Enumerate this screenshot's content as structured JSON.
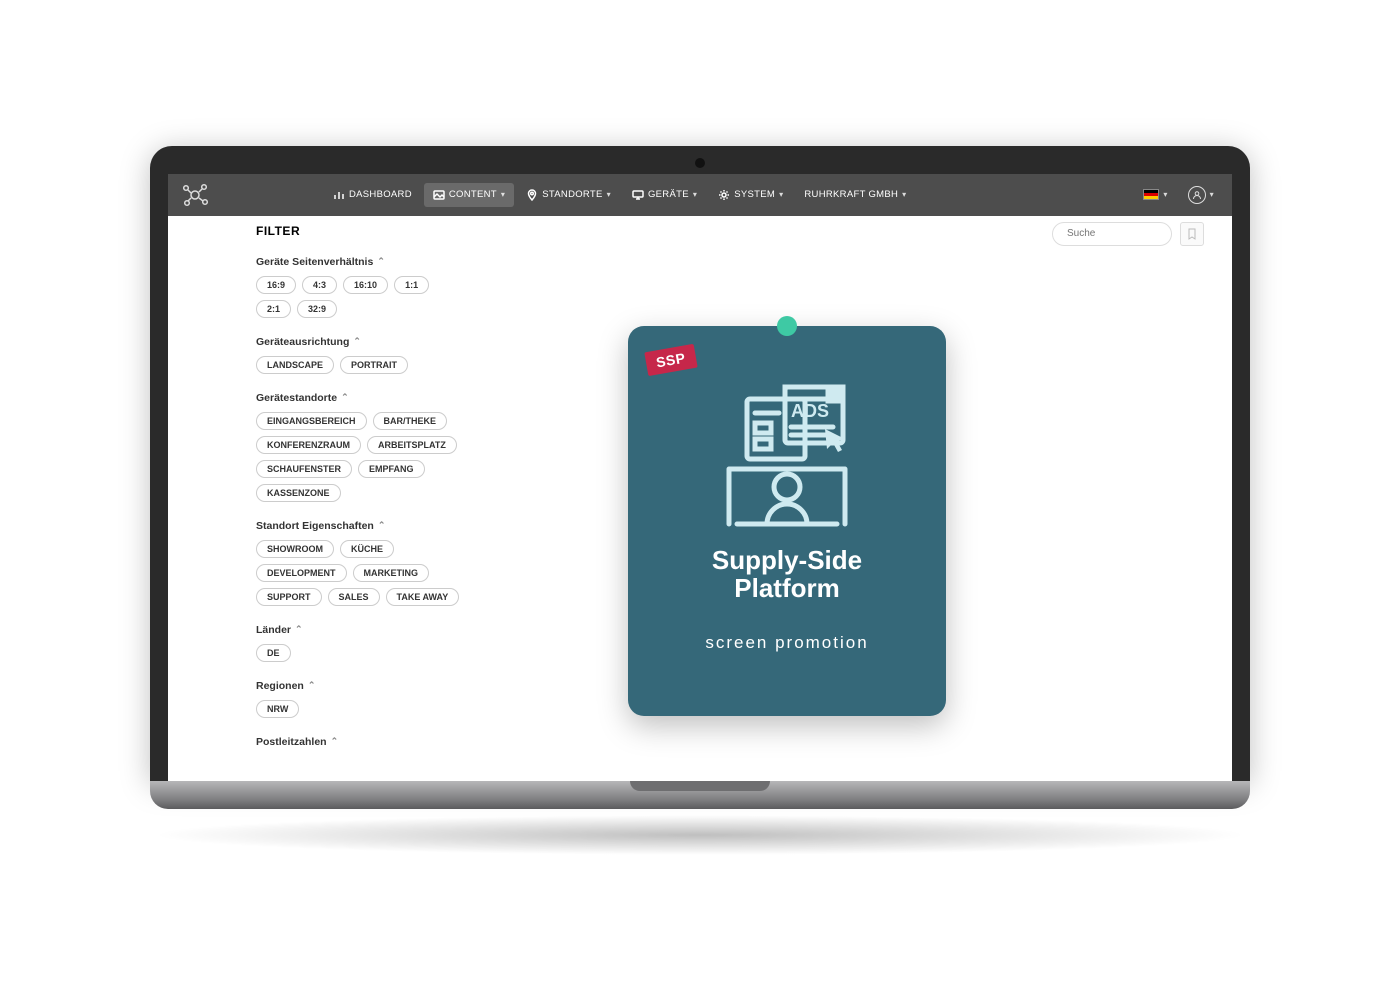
{
  "nav": {
    "dashboard": "DASHBOARD",
    "content": "CONTENT",
    "standorte": "STANDORTE",
    "geraete": "GERÄTE",
    "system": "SYSTEM",
    "company": "RUHRKRAFT GMBH"
  },
  "filter": {
    "title": "FILTER",
    "sections": {
      "aspect": {
        "label": "Geräte Seitenverhältnis",
        "chips": [
          "16:9",
          "4:3",
          "16:10",
          "1:1",
          "2:1",
          "32:9"
        ]
      },
      "orientation": {
        "label": "Geräteausrichtung",
        "chips": [
          "LANDSCAPE",
          "PORTRAIT"
        ]
      },
      "deviceLocations": {
        "label": "Gerätestandorte",
        "chips": [
          "EINGANGSBEREICH",
          "BAR/THEKE",
          "KONFERENZRAUM",
          "ARBEITSPLATZ",
          "SCHAUFENSTER",
          "EMPFANG",
          "KASSENZONE"
        ]
      },
      "locationProps": {
        "label": "Standort Eigenschaften",
        "chips": [
          "SHOWROOM",
          "KÜCHE",
          "DEVELOPMENT",
          "MARKETING",
          "SUPPORT",
          "SALES",
          "TAKE AWAY"
        ]
      },
      "countries": {
        "label": "Länder",
        "chips": [
          "DE"
        ]
      },
      "regions": {
        "label": "Regionen",
        "chips": [
          "NRW"
        ]
      },
      "postcodes": {
        "label": "Postleitzahlen",
        "chips": []
      }
    }
  },
  "search": {
    "placeholder": "Suche"
  },
  "card": {
    "badge": "SSP",
    "ads_label": "ADS",
    "title_line1": "Supply-Side",
    "title_line2": "Platform",
    "subtitle": "screen promotion"
  }
}
